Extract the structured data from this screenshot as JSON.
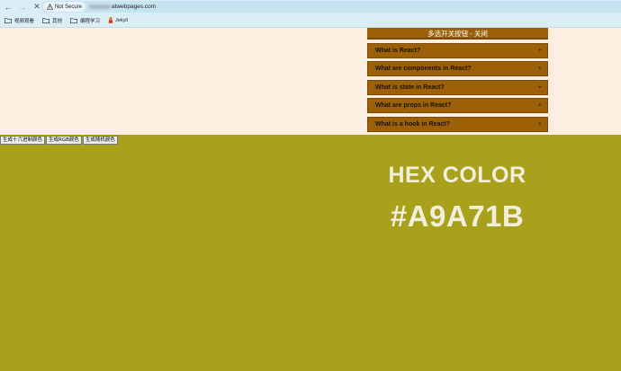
{
  "browser": {
    "security_label": "Not Secure",
    "url_visible": "atwebpages.com",
    "bookmarks": [
      {
        "label": "视频观看",
        "icon": "folder-icon"
      },
      {
        "label": "其他",
        "icon": "folder-icon"
      },
      {
        "label": "编程学习",
        "icon": "folder-icon"
      },
      {
        "label": "Jekyll",
        "icon": "jekyll-icon"
      }
    ]
  },
  "accordion": {
    "toggle_label": "多选开关按钮 - 关闭",
    "items": [
      {
        "label": "What is React?",
        "expand_symbol": "+"
      },
      {
        "label": "What are components in React?",
        "expand_symbol": "+"
      },
      {
        "label": "What is state in React?",
        "expand_symbol": "+"
      },
      {
        "label": "What are props in React?",
        "expand_symbol": "+"
      },
      {
        "label": "What is a hook in React?",
        "expand_symbol": "+"
      }
    ]
  },
  "color_generator": {
    "buttons": [
      {
        "label": "生成十六进制颜色"
      },
      {
        "label": "生成RGB颜色"
      },
      {
        "label": "生成随机颜色"
      }
    ],
    "heading": "HEX COLOR",
    "value": "#A9A71B",
    "background_color": "#a9a01b",
    "text_color": "#f2eedc"
  },
  "colors": {
    "page_bg": "#fdeee2",
    "accordion_bg": "#9c6108",
    "browser_bg": "#d9eef7"
  }
}
